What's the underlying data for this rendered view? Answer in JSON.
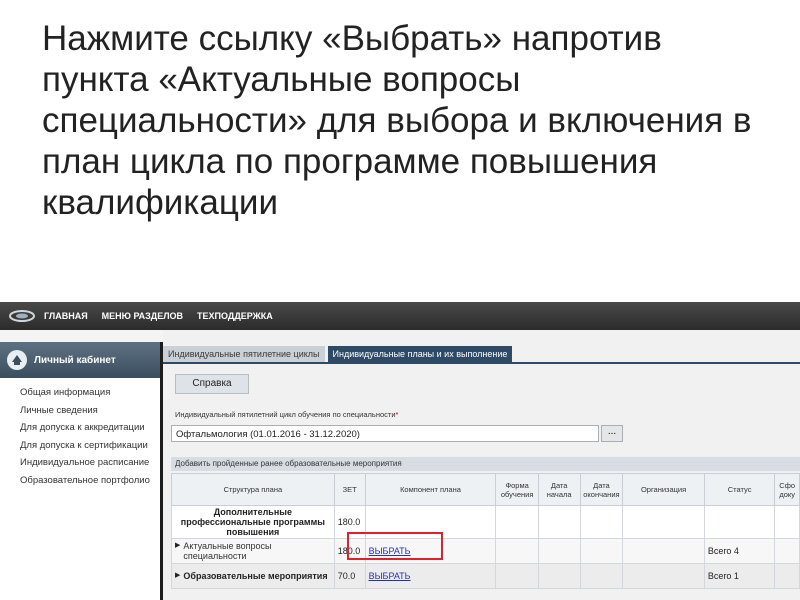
{
  "slide": {
    "title": "Нажмите ссылку «Выбрать» напротив пункта «Актуальные вопросы специальности» для выбора и включения в план цикла по программе повышения квалификации"
  },
  "topnav": {
    "items": [
      "ГЛАВНАЯ",
      "МЕНЮ РАЗДЕЛОВ",
      "ТЕХПОДДЕРЖКА"
    ]
  },
  "sidebar": {
    "header": "Личный кабинет",
    "items": [
      "Общая информация",
      "Личные сведения",
      "Для допуска к аккредитации",
      "Для допуска к сертификации",
      "Индивидуальное расписание",
      "Образовательное портфолио"
    ]
  },
  "tabs": [
    {
      "label": "Индивидуальные пятилетние циклы",
      "active": false
    },
    {
      "label": "Индивидуальные планы и их выполнение",
      "active": true
    }
  ],
  "help_button": "Справка",
  "cycle": {
    "label": "Индивидуальный пятилетний цикл обучения по специальности",
    "required_mark": "*",
    "value": "Офтальмология (01.01.2016 - 31.12.2020)",
    "picker": "..."
  },
  "section_title": "Добавить пройденные ранее образовательные мероприятия",
  "table": {
    "headers": [
      "Структура плана",
      "ЗЕТ",
      "Компонент плана",
      "Форма обучения",
      "Дата начала",
      "Дата окончания",
      "Организация",
      "Статус",
      "Сфо доку"
    ],
    "rows": [
      {
        "name": "Дополнительные профессиональные программы повышения",
        "zet": "180.0",
        "component": "",
        "status": ""
      },
      {
        "name": "Актуальные вопросы специальности",
        "zet": "180.0",
        "component": "ВЫБРАТЬ",
        "status": "Всего 4"
      },
      {
        "name": "Образовательные мероприятия",
        "zet": "70.0",
        "component": "ВЫБРАТЬ",
        "status": "Всего 1"
      }
    ]
  },
  "colors": {
    "highlight": "#e0202a",
    "link": "#2431b5",
    "active_tab": "#2f4a66"
  }
}
